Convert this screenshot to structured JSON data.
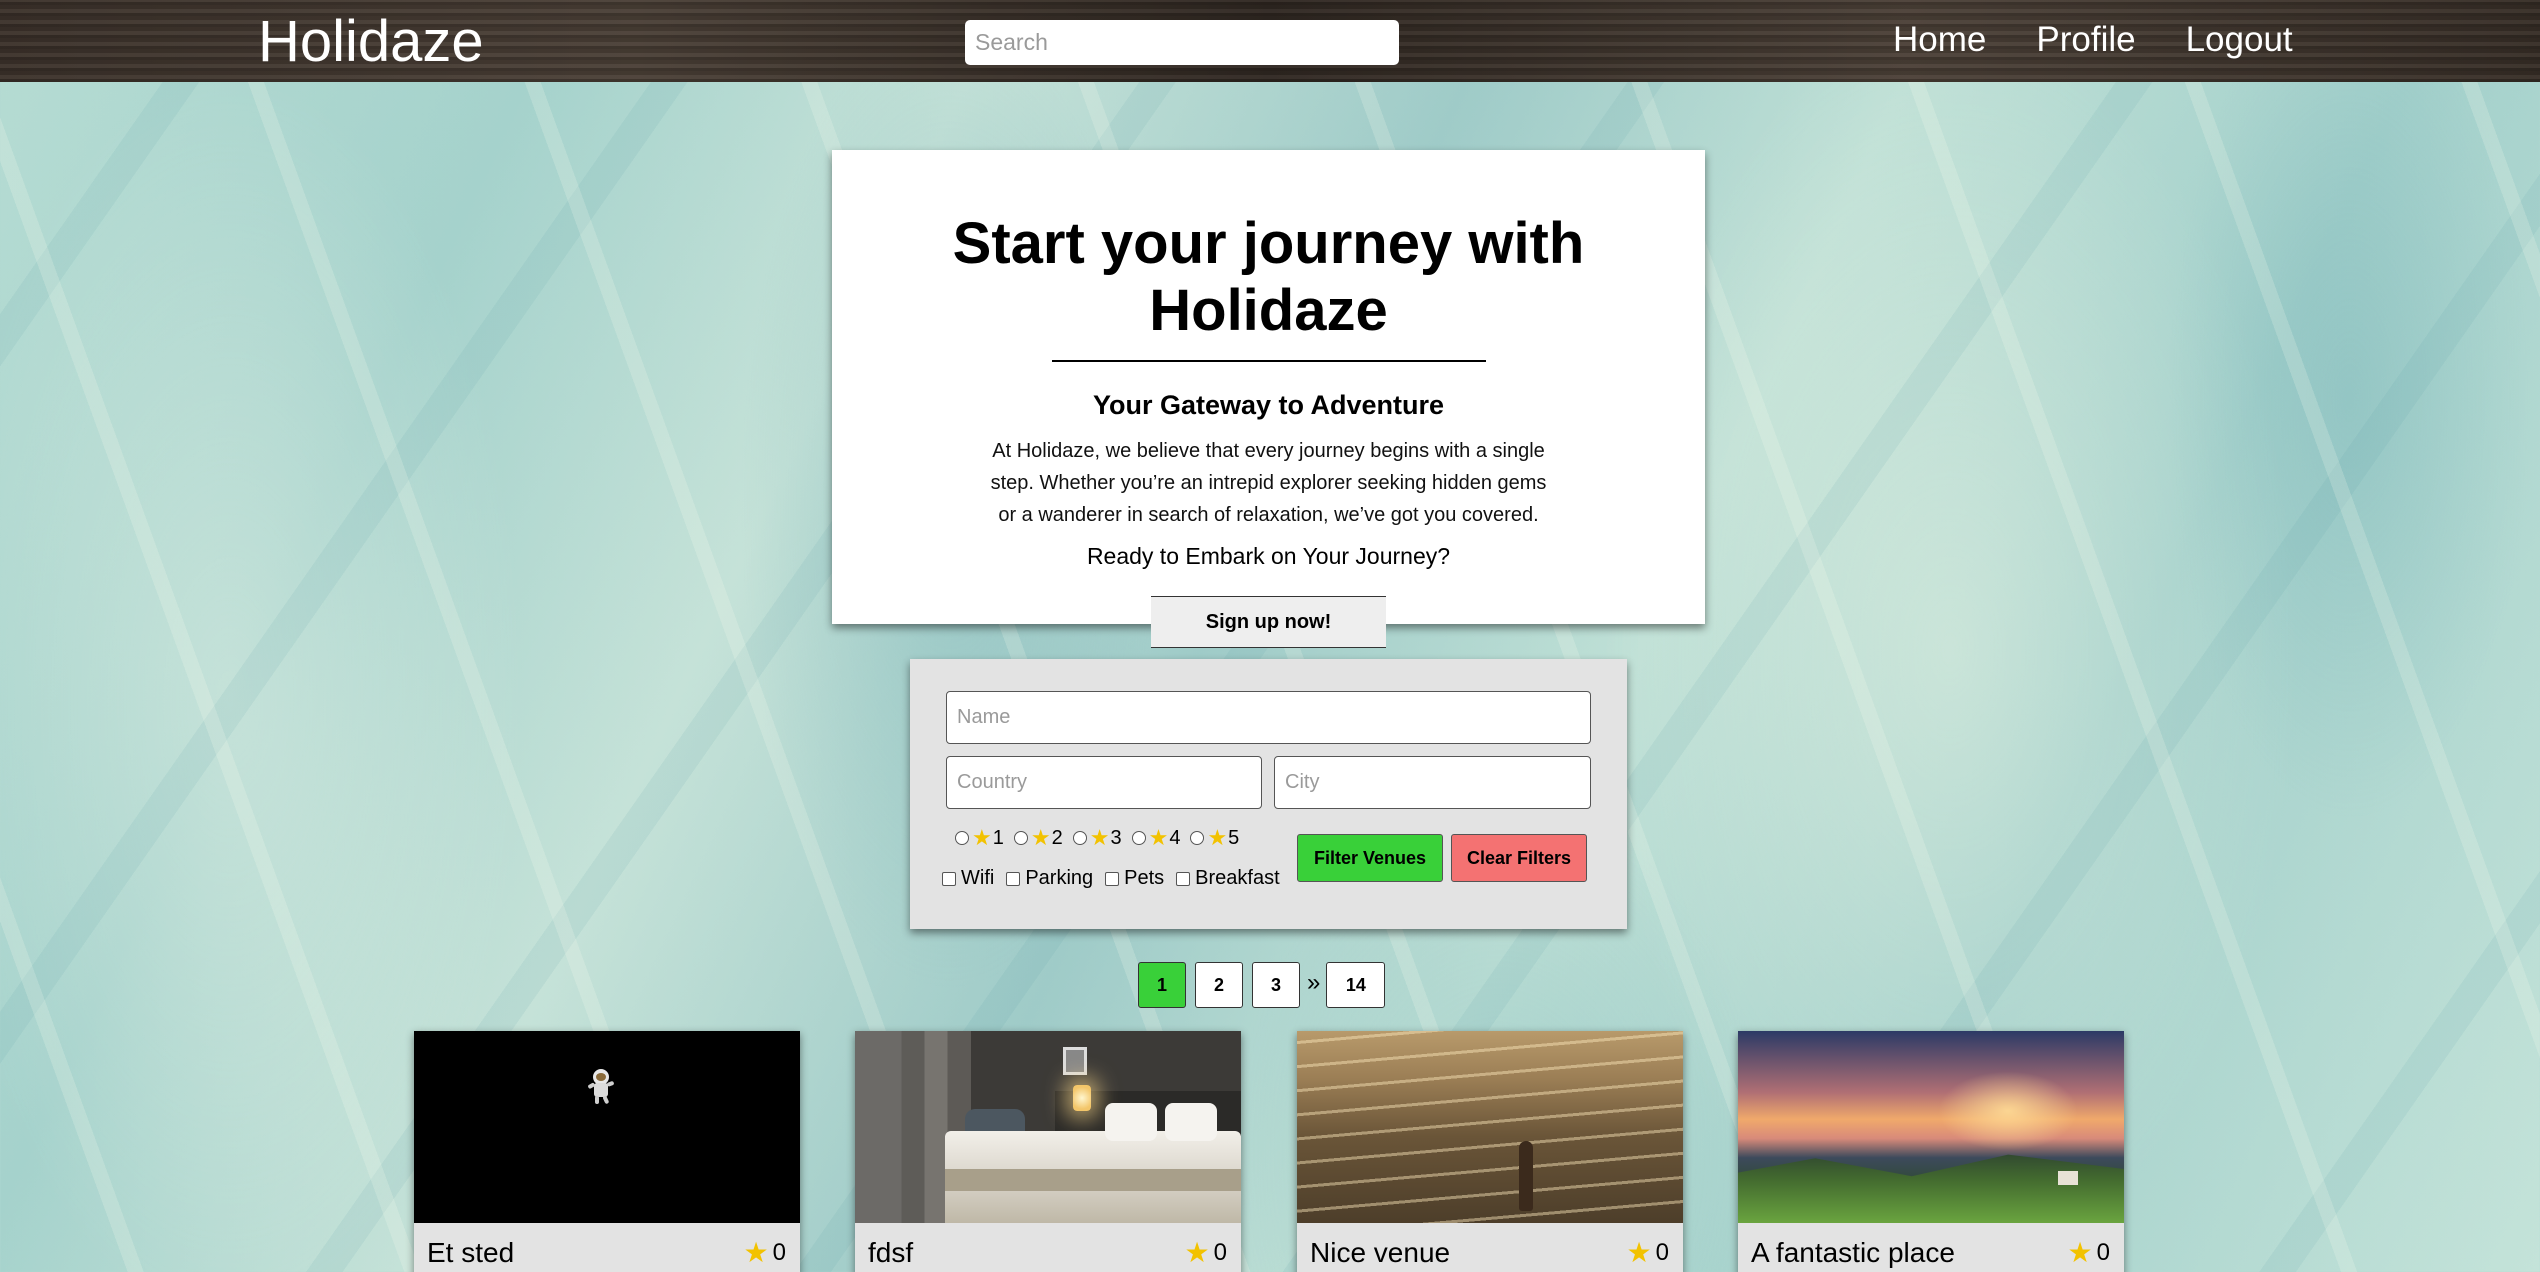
{
  "header": {
    "logo": "Holidaze",
    "search_placeholder": "Search",
    "nav": [
      "Home",
      "Profile",
      "Logout"
    ]
  },
  "hero": {
    "title": "Start your journey with Holidaze",
    "subtitle": "Your Gateway to Adventure",
    "description": "At Holidaze, we believe that every journey begins with a single step. Whether you’re an intrepid explorer seeking hidden gems or a wanderer in search of relaxation, we’ve got you covered.",
    "prompt": "Ready to Embark on Your Journey?",
    "signup_label": "Sign up now!"
  },
  "filter": {
    "name_placeholder": "Name",
    "country_placeholder": "Country",
    "city_placeholder": "City",
    "ratings": [
      "1",
      "2",
      "3",
      "4",
      "5"
    ],
    "amenities": [
      "Wifi",
      "Parking",
      "Pets",
      "Breakfast"
    ],
    "filter_label": "Filter Venues",
    "clear_label": "Clear Filters",
    "colors": {
      "filter": "#39d039",
      "clear": "#f47272"
    }
  },
  "pagination": {
    "pages": [
      "1",
      "2",
      "3"
    ],
    "separator": "»",
    "last": "14",
    "active": "1"
  },
  "venues": [
    {
      "name": "Et sted",
      "rating": "0",
      "image": "astronaut-in-space"
    },
    {
      "name": "fdsf",
      "rating": "0",
      "image": "hotel-bedroom"
    },
    {
      "name": "Nice venue",
      "rating": "0",
      "image": "person-in-sea-at-sunset"
    },
    {
      "name": "A fantastic place",
      "rating": "0",
      "image": "mountain-valley-sunset"
    }
  ]
}
